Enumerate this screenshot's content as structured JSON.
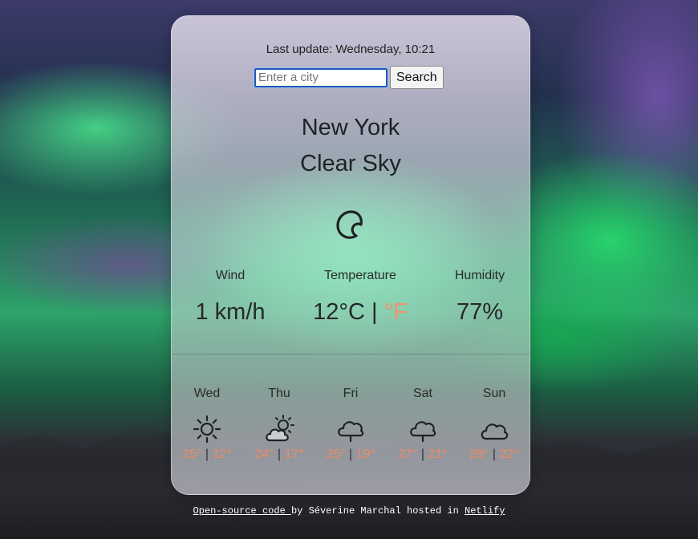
{
  "last_update": "Last update: Wednesday, 10:21",
  "search": {
    "placeholder": "Enter a city",
    "button_label": "Search"
  },
  "current": {
    "city": "New York",
    "description": "Clear Sky",
    "icon": "crescent-moon-icon",
    "wind": {
      "label": "Wind",
      "value": "1 km/h"
    },
    "temperature": {
      "label": "Temperature",
      "value": "12°C",
      "separator": "|",
      "alt_unit": "°F"
    },
    "humidity": {
      "label": "Humidity",
      "value": "77%"
    }
  },
  "forecast": [
    {
      "day": "Wed",
      "icon": "sun-icon",
      "max": "25°",
      "sep": "|",
      "min": "12°"
    },
    {
      "day": "Thu",
      "icon": "partly-cloudy-icon",
      "max": "24°",
      "sep": "|",
      "min": "17°"
    },
    {
      "day": "Fri",
      "icon": "rain-cloud-icon",
      "max": "25°",
      "sep": "|",
      "min": "19°"
    },
    {
      "day": "Sat",
      "icon": "rain-cloud-icon",
      "max": "27°",
      "sep": "|",
      "min": "21°"
    },
    {
      "day": "Sun",
      "icon": "cloud-icon",
      "max": "28°",
      "sep": "|",
      "min": "22°"
    }
  ],
  "footer": {
    "code_link": "Open-source code ",
    "by_text": "by Séverine Marchal hosted in ",
    "host_link": "Netlify"
  },
  "colors": {
    "accent": "#f39370",
    "text": "#1e2226",
    "input_border": "#1d5bb8"
  }
}
